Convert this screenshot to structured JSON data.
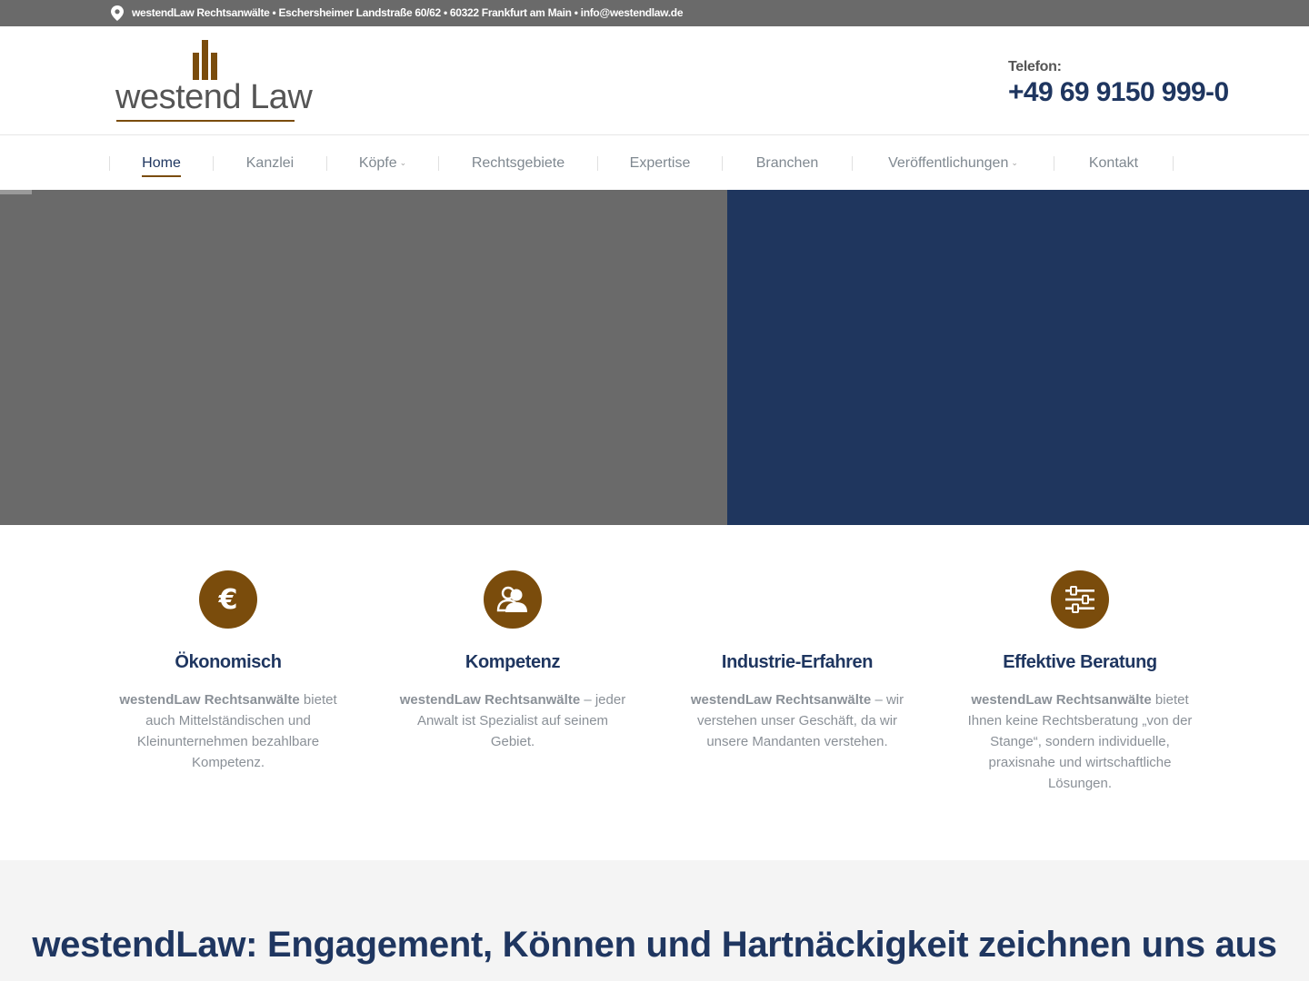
{
  "topbar": {
    "address": "westendLaw Rechtsanwälte • Eschersheimer Landstraße 60/62 • 60322 Frankfurt am Main • info@westendlaw.de",
    "icon": "map-pin-icon"
  },
  "header": {
    "logo_text": "westend Law",
    "phone_label": "Telefon:",
    "phone_number": "+49 69 9150 999-0"
  },
  "nav": {
    "items": [
      {
        "label": "Home",
        "active": true
      },
      {
        "label": "Kanzlei"
      },
      {
        "label": "Köpfe",
        "has_submenu": true
      },
      {
        "label": "Rechtsgebiete"
      },
      {
        "label": "Expertise"
      },
      {
        "label": "Branchen"
      },
      {
        "label": "Veröffentlichungen",
        "has_submenu": true
      },
      {
        "label": "Kontakt"
      }
    ]
  },
  "features": [
    {
      "icon": "euro-icon",
      "title": "Ökonomisch",
      "bold": "westendLaw Rechtsanwälte",
      "text": " bietet auch Mittelständischen und Kleinunternehmen bezahlbare Kompetenz."
    },
    {
      "icon": "users-icon",
      "title": "Kompetenz",
      "bold": "westendLaw Rechtsanwälte",
      "text": " – jeder Anwalt ist Spezialist auf seinem Gebiet."
    },
    {
      "icon": "",
      "title": "Industrie-Erfahren",
      "bold": "westendLaw Rechtsanwälte",
      "text": " – wir verstehen unser Geschäft, da wir unsere Mandanten verstehen."
    },
    {
      "icon": "sliders-icon",
      "title": "Effektive Beratung",
      "bold": "westendLaw Rechtsanwälte",
      "text": " bietet Ihnen keine Rechtsberatung „von der Stange“, sondern individuelle, praxisnahe und wirtschaftliche Lösungen."
    }
  ],
  "headline": "westendLaw: Engagement, Können und Hartnäckigkeit zeichnen uns aus",
  "colors": {
    "brand_brown": "#7a4c0c",
    "brand_navy": "#1f3660",
    "topbar_gray": "#6a6a6a"
  }
}
